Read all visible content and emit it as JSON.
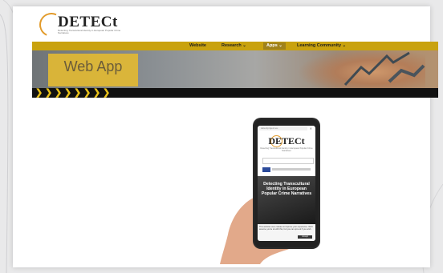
{
  "brand": {
    "name": "DETECt",
    "tagline": "Detecting Transcultural Identity in European Popular Crime Narratives"
  },
  "nav": {
    "items": [
      {
        "label": "Website",
        "active": false
      },
      {
        "label": "Research ⌄",
        "active": false
      },
      {
        "label": "Apps ⌄",
        "active": true
      },
      {
        "label": "Learning Community ⌄",
        "active": false
      }
    ]
  },
  "hero": {
    "title": "Web App"
  },
  "phone": {
    "url": "detectproject.eu",
    "logo": "DETECt",
    "tagline": "Detecting Transcultural Identity in European Popular Crime Narratives",
    "headline": "Detecting Transcultural Identity in European Popular Crime Narratives",
    "cookie_text": "This website uses cookies to improve your experience. We'll assume you're ok with this, but you can opt-out if you wish.",
    "cookie_button": "Accept"
  },
  "colors": {
    "accent": "#c9a20e",
    "title_box": "#e1b934",
    "stripe": "#111111",
    "chevrons": "#e8c11a"
  }
}
